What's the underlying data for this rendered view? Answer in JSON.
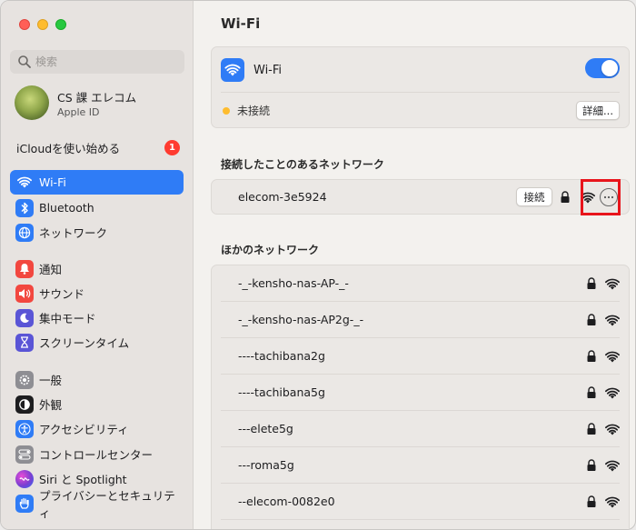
{
  "window": {
    "title": "Wi-Fi"
  },
  "sidebar": {
    "search_placeholder": "検索",
    "account": {
      "name": "CS 課 エレコム",
      "subtitle": "Apple ID"
    },
    "icloud": {
      "label": "iCloudを使い始める",
      "badge": "1"
    },
    "items": [
      {
        "label": "Wi-Fi",
        "icon": "wifi-icon",
        "color": "#2f7cf6",
        "active": true
      },
      {
        "label": "Bluetooth",
        "icon": "bluetooth-icon",
        "color": "#2f7cf6"
      },
      {
        "label": "ネットワーク",
        "icon": "globe-icon",
        "color": "#2f7cf6"
      },
      {
        "label": "通知",
        "icon": "bell-icon",
        "color": "#f2473f"
      },
      {
        "label": "サウンド",
        "icon": "speaker-icon",
        "color": "#f2473f"
      },
      {
        "label": "集中モード",
        "icon": "moon-icon",
        "color": "#5a55d6"
      },
      {
        "label": "スクリーンタイム",
        "icon": "hourglass-icon",
        "color": "#5a55d6"
      },
      {
        "label": "一般",
        "icon": "gear-icon",
        "color": "#8e8e93"
      },
      {
        "label": "外観",
        "icon": "appearance-icon",
        "color": "#1d1d1f"
      },
      {
        "label": "アクセシビリティ",
        "icon": "accessibility-icon",
        "color": "#2f7cf6"
      },
      {
        "label": "コントロールセンター",
        "icon": "control-center-icon",
        "color": "#8e8e93"
      },
      {
        "label": "Siri と Spotlight",
        "icon": "siri-icon",
        "color": "#7a3fd1"
      },
      {
        "label": "プライバシーとセキュリティ",
        "icon": "hand-icon",
        "color": "#2f7cf6"
      }
    ]
  },
  "wifi_panel": {
    "wifi_label": "Wi-Fi",
    "toggle_on": true,
    "status": "未接続",
    "details_button": "詳細..."
  },
  "known_networks": {
    "heading": "接続したことのあるネットワーク",
    "items": [
      {
        "name": "elecom-3e5924",
        "connect_button": "接続"
      }
    ]
  },
  "other_networks": {
    "heading": "ほかのネットワーク",
    "items": [
      {
        "name": "-_-kensho-nas-AP-_-"
      },
      {
        "name": "-_-kensho-nas-AP2g-_-"
      },
      {
        "name": "----tachibana2g"
      },
      {
        "name": "----tachibana5g"
      },
      {
        "name": "---elete5g"
      },
      {
        "name": "---roma5g"
      },
      {
        "name": "--elecom-0082e0"
      }
    ]
  },
  "colors": {
    "accent": "#2f7cf6",
    "highlight": "#e8141b",
    "status_dot": "#febc2e",
    "badge": "#ff3b30"
  }
}
